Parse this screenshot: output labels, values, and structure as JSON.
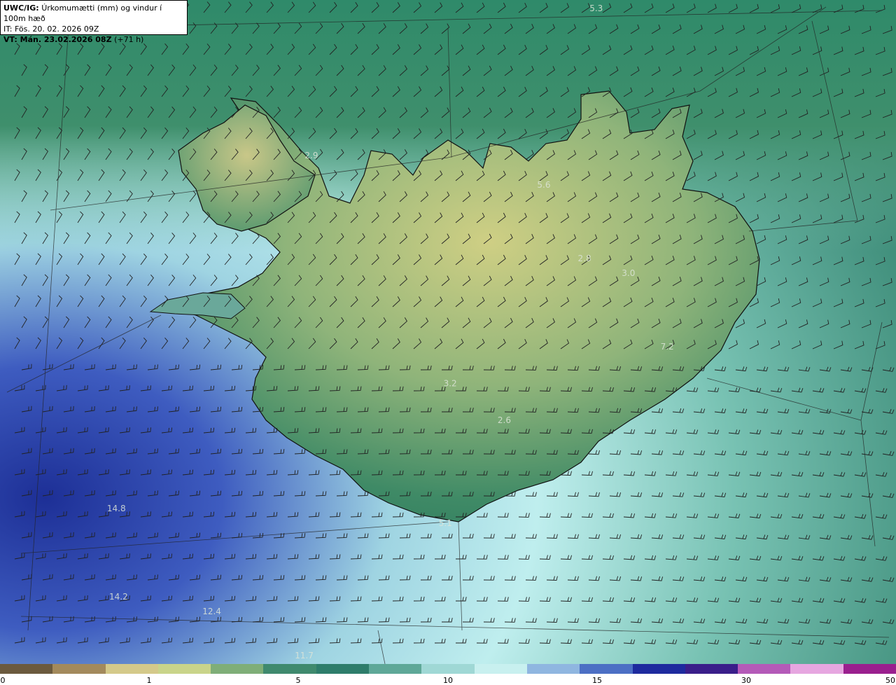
{
  "header": {
    "model": "UWC/IG:",
    "title": "Úrkomumætti (mm) og vindur í 100m hæð",
    "it_line": "IT: Fös. 20. 02. 2026 09Z",
    "vt_prefix": "VT: Mán. 23.02.2026 08Z",
    "vt_suffix": "(+71 h)"
  },
  "value_labels": [
    {
      "text": "5.3",
      "lon": -15.5,
      "lat": 67.2
    },
    {
      "text": "2.9",
      "lon": -22.4,
      "lat": 66.2
    },
    {
      "text": "5.6",
      "lon": -16.9,
      "lat": 66.0
    },
    {
      "text": "2.8",
      "lon": -16.0,
      "lat": 65.5
    },
    {
      "text": "3.0",
      "lon": -15.0,
      "lat": 65.4
    },
    {
      "text": "7.2",
      "lon": -14.2,
      "lat": 64.9
    },
    {
      "text": "3.2",
      "lon": -19.1,
      "lat": 64.65
    },
    {
      "text": "2.6",
      "lon": -17.9,
      "lat": 64.4
    },
    {
      "text": "5.1",
      "lon": -19.2,
      "lat": 63.7
    },
    {
      "text": "14.8",
      "lon": -26.4,
      "lat": 63.8
    },
    {
      "text": "14.2",
      "lon": -26.2,
      "lat": 63.2
    },
    {
      "text": "12.4",
      "lon": -24.2,
      "lat": 63.1
    },
    {
      "text": "11.7",
      "lon": -22.2,
      "lat": 62.7
    }
  ],
  "colorbar": {
    "ticks": [
      "0",
      "1",
      "5",
      "10",
      "15",
      "30",
      "50"
    ],
    "colors": [
      "#6b5a3e",
      "#a38a5c",
      "#d4c98a",
      "#c9d48a",
      "#7fae78",
      "#3f8a6e",
      "#2e7d6b",
      "#5ea898",
      "#9fd8d5",
      "#c8f0ef",
      "#8fb6e0",
      "#4c6fc4",
      "#1e2a9e",
      "#3a1e8a",
      "#b45ab8",
      "#e6a6e0",
      "#9a1f8e"
    ]
  },
  "colors": {
    "sea_deep": "#1a2a8c",
    "sea_light": "#bfeeee",
    "land_low": "#2f7a5e",
    "land_high": "#d6d48a",
    "coast": "#111111"
  }
}
